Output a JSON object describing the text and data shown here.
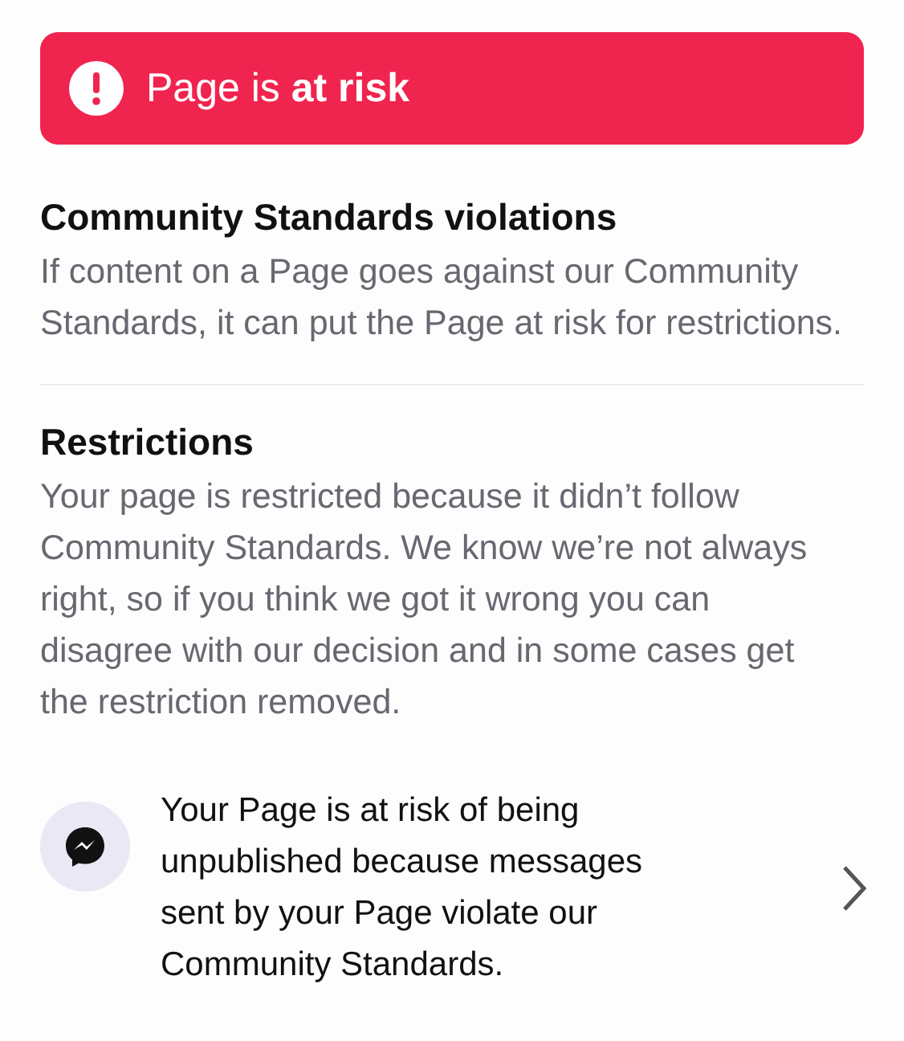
{
  "banner": {
    "text": "Page is **at risk**"
  },
  "sections": [
    {
      "title": "Community Standards violations",
      "body": "If content on a Page goes against our Community Standards, it can put the Page at risk for restrictions."
    },
    {
      "title": "Restrictions",
      "body": "Your page is restricted because it didn’t follow Community Standards. We know we’re not always right, so if you think we got it wrong you can disagree with our decision and in some cases get the restriction removed."
    }
  ],
  "items": [
    {
      "kind": "messenger",
      "text": "Your Page is at risk of being unpublished because messages sent by your Page violate our Community Standards."
    }
  ]
}
